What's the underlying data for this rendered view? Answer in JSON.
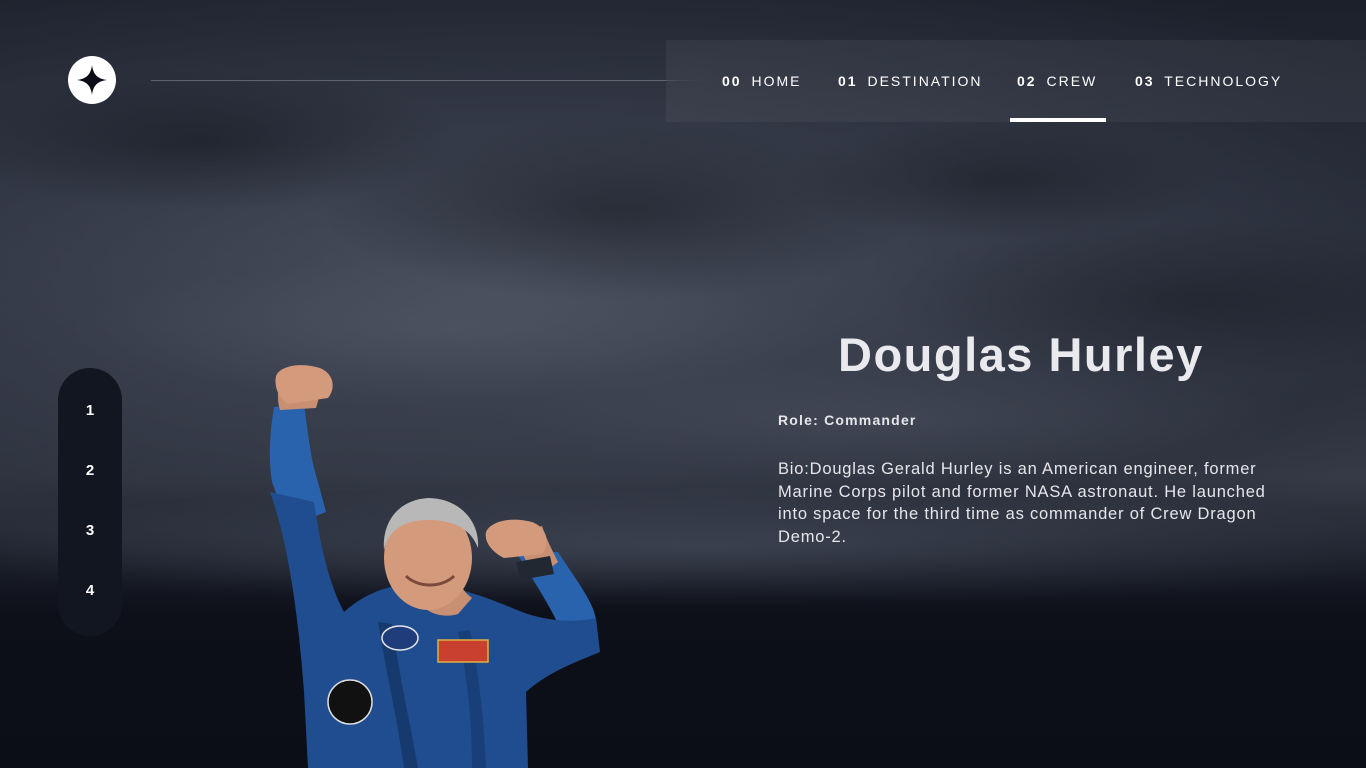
{
  "header": {
    "logo_icon": "star-compass-icon",
    "nav": [
      {
        "num": "00",
        "label": "HOME",
        "active": false
      },
      {
        "num": "01",
        "label": "DESTINATION",
        "active": false
      },
      {
        "num": "02",
        "label": "CREW",
        "active": true
      },
      {
        "num": "03",
        "label": "TECHNOLOGY",
        "active": false
      }
    ]
  },
  "crew": {
    "pages": [
      "1",
      "2",
      "3",
      "4"
    ],
    "name": "Douglas Hurley",
    "role": "Role: Commander",
    "bio": "Bio:Douglas Gerald Hurley is an American engineer, former Marine Corps pilot and former NASA astronaut. He launched into space for the third time as commander of Crew Dragon Demo-2."
  },
  "colors": {
    "background": "#0b0d17",
    "accent": "#ffffff",
    "suit": "#1f4d8f"
  }
}
